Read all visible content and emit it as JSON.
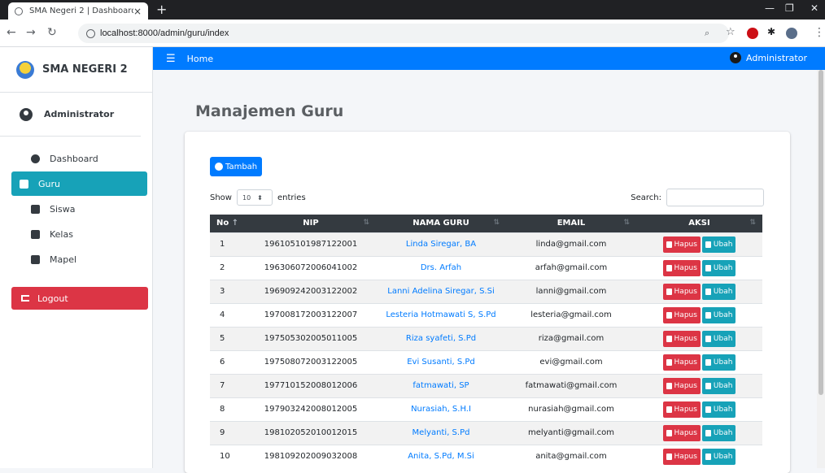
{
  "browser": {
    "tab_title": "SMA Negeri 2 | Dashboard",
    "tab_close": "×",
    "new_tab": "+",
    "url": "localhost:8000/admin/guru/index"
  },
  "sidebar": {
    "brand": "SMA NEGERI 2",
    "user": "Administrator",
    "items": [
      {
        "label": "Dashboard",
        "icon": "dashboard-icon"
      },
      {
        "label": "Guru",
        "icon": "book-icon",
        "active": true
      },
      {
        "label": "Siswa",
        "icon": "book-icon"
      },
      {
        "label": "Kelas",
        "icon": "book-icon"
      },
      {
        "label": "Mapel",
        "icon": "book-icon"
      }
    ],
    "logout": "Logout"
  },
  "navbar": {
    "home": "Home",
    "user": "Administrator"
  },
  "page": {
    "title": "Manajemen Guru",
    "add_button": "Tambah",
    "show_label": "Show",
    "show_value": "10",
    "entries_label": "entries",
    "search_label": "Search:"
  },
  "table": {
    "headers": [
      "No",
      "NIP",
      "NAMA GURU",
      "EMAIL",
      "AKSI"
    ],
    "delete_label": "Hapus",
    "edit_label": "Ubah",
    "rows": [
      {
        "no": "1",
        "nip": "196105101987122001",
        "name": "Linda Siregar, BA",
        "email": "linda@gmail.com"
      },
      {
        "no": "2",
        "nip": "196306072006041002",
        "name": "Drs. Arfah",
        "email": "arfah@gmail.com"
      },
      {
        "no": "3",
        "nip": "196909242003122002",
        "name": "Lanni Adelina Siregar, S.Si",
        "email": "lanni@gmail.com"
      },
      {
        "no": "4",
        "nip": "197008172003122007",
        "name": "Lesteria Hotmawati S, S.Pd",
        "email": "lesteria@gmail.com"
      },
      {
        "no": "5",
        "nip": "197505302005011005",
        "name": "Riza syafeti, S.Pd",
        "email": "riza@gmail.com"
      },
      {
        "no": "6",
        "nip": "197508072003122005",
        "name": "Evi Susanti, S.Pd",
        "email": "evi@gmail.com"
      },
      {
        "no": "7",
        "nip": "197710152008012006",
        "name": "fatmawati, SP",
        "email": "fatmawati@gmail.com"
      },
      {
        "no": "8",
        "nip": "197903242008012005",
        "name": "Nurasiah, S.H.I",
        "email": "nurasiah@gmail.com"
      },
      {
        "no": "9",
        "nip": "198102052010012015",
        "name": "Melyanti, S.Pd",
        "email": "melyanti@gmail.com"
      },
      {
        "no": "10",
        "nip": "198109202009032008",
        "name": "Anita, S.Pd, M.Si",
        "email": "anita@gmail.com"
      }
    ]
  }
}
